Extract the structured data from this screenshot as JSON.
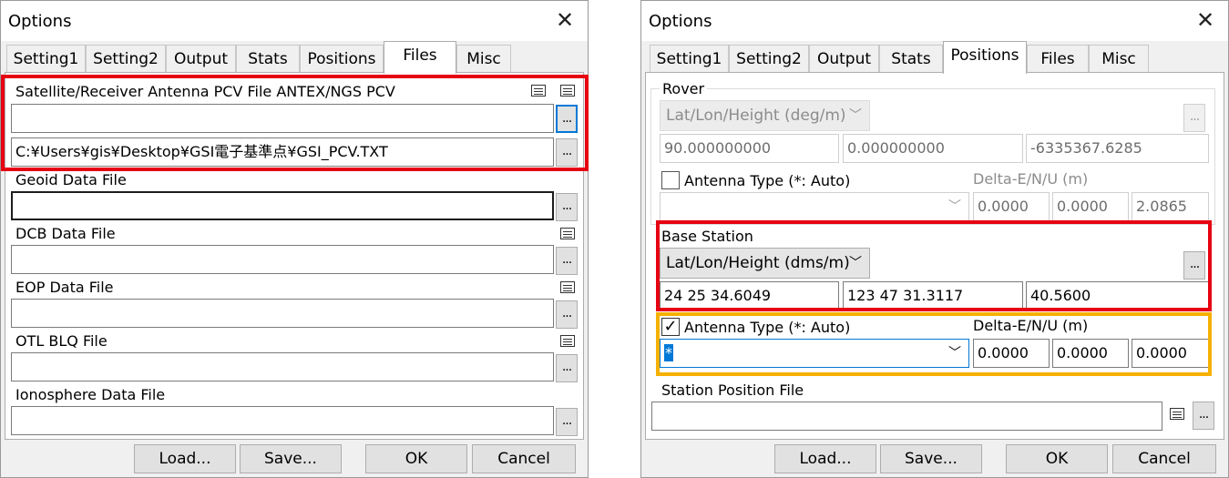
{
  "left": {
    "title": "Options",
    "tabs": [
      "Setting1",
      "Setting2",
      "Output",
      "Stats",
      "Positions",
      "Files",
      "Misc"
    ],
    "fields": {
      "antenna_label": "Satellite/Receiver Antenna PCV File ANTEX/NGS PCV",
      "antenna_value_1": "",
      "antenna_value_2": "C:¥Users¥gis¥Desktop¥GSI電子基準点¥GSI_PCV.TXT",
      "geoid_label": "Geoid Data File",
      "dcb_label": "DCB Data File",
      "eop_label": "EOP Data File",
      "otl_label": "OTL BLQ File",
      "iono_label": "Ionosphere Data File"
    },
    "browse": "...",
    "buttons": {
      "load": "Load...",
      "save": "Save...",
      "ok": "OK",
      "cancel": "Cancel"
    }
  },
  "right": {
    "title": "Options",
    "tabs": [
      "Setting1",
      "Setting2",
      "Output",
      "Stats",
      "Positions",
      "Files",
      "Misc"
    ],
    "rover": {
      "group_label": "Rover",
      "format": "Lat/Lon/Height (deg/m)",
      "lat": "90.000000000",
      "lon": "0.000000000",
      "height": "-6335367.6285",
      "antenna_label": "Antenna Type (*: Auto)",
      "delta_label": "Delta-E/N/U (m)",
      "de": "0.0000",
      "dn": "0.0000",
      "du": "2.0865"
    },
    "base": {
      "group_label": "Base Station",
      "format": "Lat/Lon/Height (dms/m)",
      "lat": "24 25 34.6049",
      "lon": "123 47 31.3117",
      "height": "40.5600",
      "antenna_label": "Antenna Type (*: Auto)",
      "antenna_value": "*",
      "delta_label": "Delta-E/N/U (m)",
      "de": "0.0000",
      "dn": "0.0000",
      "du": "0.0000"
    },
    "station_file_label": "Station Position File",
    "browse": "...",
    "buttons": {
      "load": "Load...",
      "save": "Save...",
      "ok": "OK",
      "cancel": "Cancel"
    }
  },
  "colors": {
    "highlight_red": "#e60012",
    "highlight_yellow": "#f5b000",
    "focus_blue": "#0078d7"
  }
}
